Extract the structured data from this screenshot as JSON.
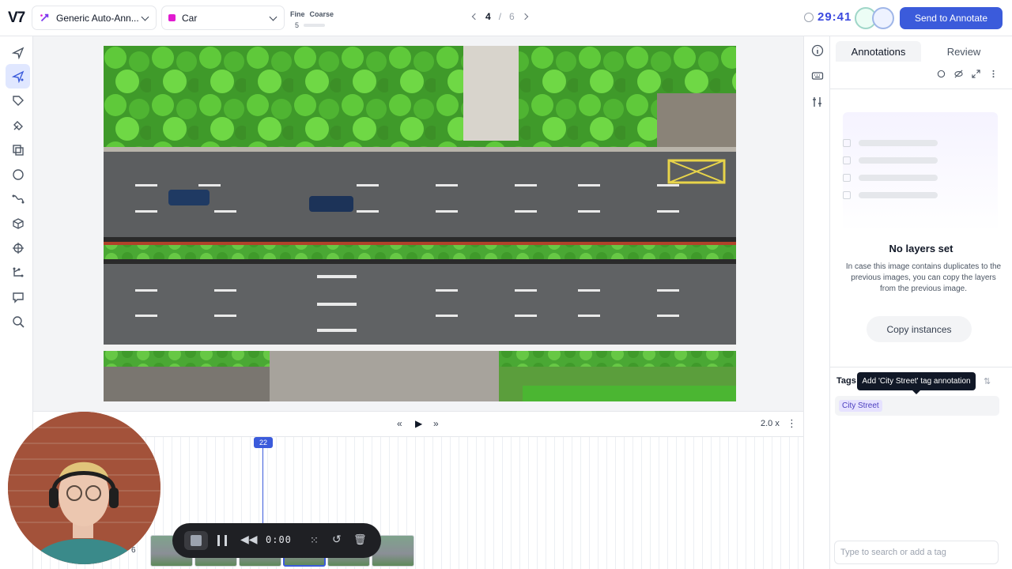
{
  "app": {
    "logo": "V7"
  },
  "topbar": {
    "model_dropdown": "Generic Auto-Ann...",
    "class_dropdown": "Car",
    "fine_label": "Fine",
    "coarse_label": "Coarse",
    "granularity_value": "5",
    "page_current": "4",
    "page_separator": "/",
    "page_total": "6",
    "timer": "29:41",
    "send_button": "Send to Annotate"
  },
  "colors": {
    "accent": "#3b5bdb",
    "class_car": "#e11bd0",
    "tag_chip_bg": "#e6e2ff"
  },
  "toolbar": {
    "tools": [
      "select-arrow-icon",
      "auto-annotate-icon",
      "tag-icon",
      "brush-icon",
      "polygon-copy-icon",
      "ellipse-icon",
      "polyline-icon",
      "cuboid-icon",
      "keypoint-icon",
      "skeleton-icon",
      "comment-icon",
      "zoom-icon"
    ],
    "active_index": 1
  },
  "panel": {
    "tabs": [
      "Annotations",
      "Review"
    ],
    "active_tab": "Annotations",
    "empty_title": "No layers set",
    "empty_desc": "In case this image contains duplicates to the previous images, you can copy the layers from the previous image.",
    "copy_button": "Copy instances",
    "tags_label": "Tags",
    "tooltip": "Add 'City Street' tag annotation",
    "tag_chip": "City Street",
    "tag_input_placeholder": "Type to search or add a tag"
  },
  "playback": {
    "speed": "2.0 x",
    "current_frame": "22"
  },
  "timeline": {
    "thumbnail_count_label": "6"
  },
  "recorder": {
    "time": "0:00"
  }
}
